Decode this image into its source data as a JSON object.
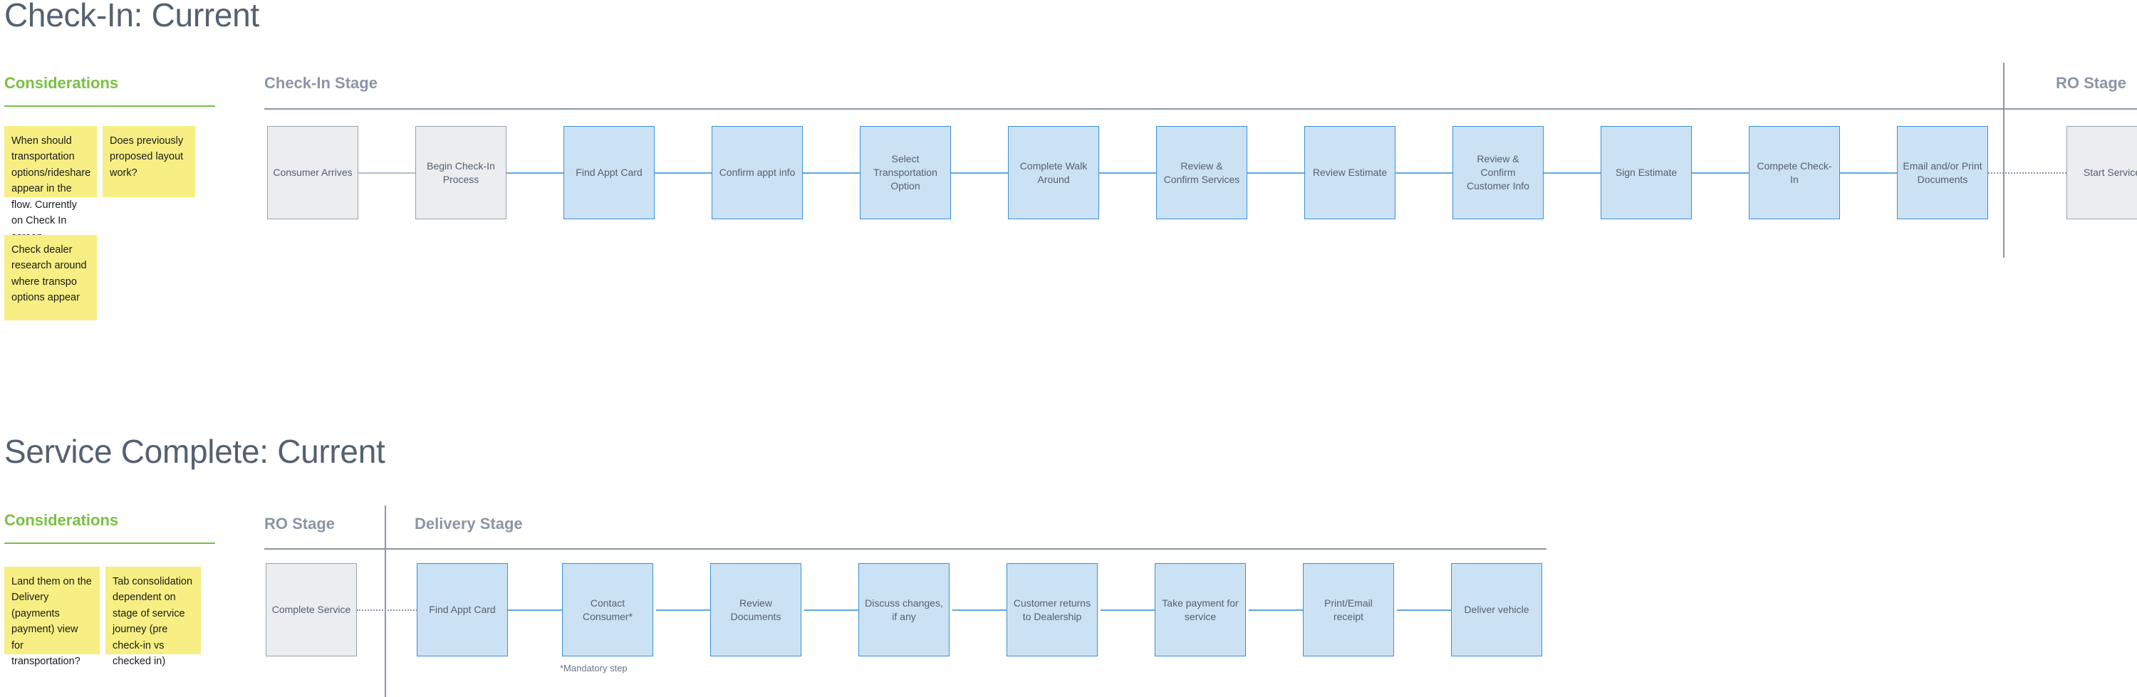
{
  "sections": [
    {
      "id": "check-in",
      "title": "Check-In: Current",
      "considerations": {
        "heading": "Considerations",
        "notes": [
          "When should transportation options/rideshare appear in the flow. Currently on Check In screen...",
          "Does previously proposed layout work?",
          "Check dealer research around where transpo options appear"
        ]
      },
      "stages": [
        {
          "label": "Check-In Stage"
        },
        {
          "label": "RO Stage"
        }
      ],
      "nodes": [
        {
          "label": "Consumer Arrives",
          "style": "grey"
        },
        {
          "label": "Begin Check-In Process",
          "style": "grey"
        },
        {
          "label": "Find Appt Card",
          "style": "blue"
        },
        {
          "label": "Confirm appt info",
          "style": "blue"
        },
        {
          "label": "Select Transportation Option",
          "style": "blue"
        },
        {
          "label": "Complete Walk Around",
          "style": "blue"
        },
        {
          "label": "Review & Confirm Services",
          "style": "blue"
        },
        {
          "label": "Review Estimate",
          "style": "blue"
        },
        {
          "label": "Review & Confirm Customer Info",
          "style": "blue"
        },
        {
          "label": "Sign Estimate",
          "style": "blue"
        },
        {
          "label": "Compete Check-In",
          "style": "blue"
        },
        {
          "label": "Email and/or Print Documents",
          "style": "blue"
        },
        {
          "label": "Start Service",
          "style": "grey"
        }
      ]
    },
    {
      "id": "service-complete",
      "title": "Service Complete: Current",
      "considerations": {
        "heading": "Considerations",
        "notes": [
          "Land them on the Delivery (payments payment) view for transportation?",
          "Tab consolidation dependent on stage of service journey (pre check-in vs checked in)"
        ]
      },
      "stages": [
        {
          "label": "RO Stage"
        },
        {
          "label": "Delivery Stage"
        }
      ],
      "nodes": [
        {
          "label": "Complete Service",
          "style": "grey"
        },
        {
          "label": "Find Appt Card",
          "style": "blue"
        },
        {
          "label": "Contact Consumer*",
          "style": "blue"
        },
        {
          "label": "Review Documents",
          "style": "blue"
        },
        {
          "label": "Discuss changes, if any",
          "style": "blue"
        },
        {
          "label": "Customer returns to Dealership",
          "style": "blue"
        },
        {
          "label": "Take payment for service",
          "style": "blue"
        },
        {
          "label": "Print/Email receipt",
          "style": "blue"
        },
        {
          "label": "Deliver vehicle",
          "style": "blue"
        }
      ],
      "footnote": "*Mandatory step"
    }
  ],
  "colors": {
    "accent_green": "#79c143",
    "stage_grey": "#8b95a6",
    "node_blue_fill": "#cbe2f5",
    "node_blue_border": "#3f90d4",
    "node_grey_fill": "#ebedef",
    "node_grey_border": "#9aa2ad",
    "sticky_yellow": "#f7ef83",
    "title_slate": "#556070"
  }
}
